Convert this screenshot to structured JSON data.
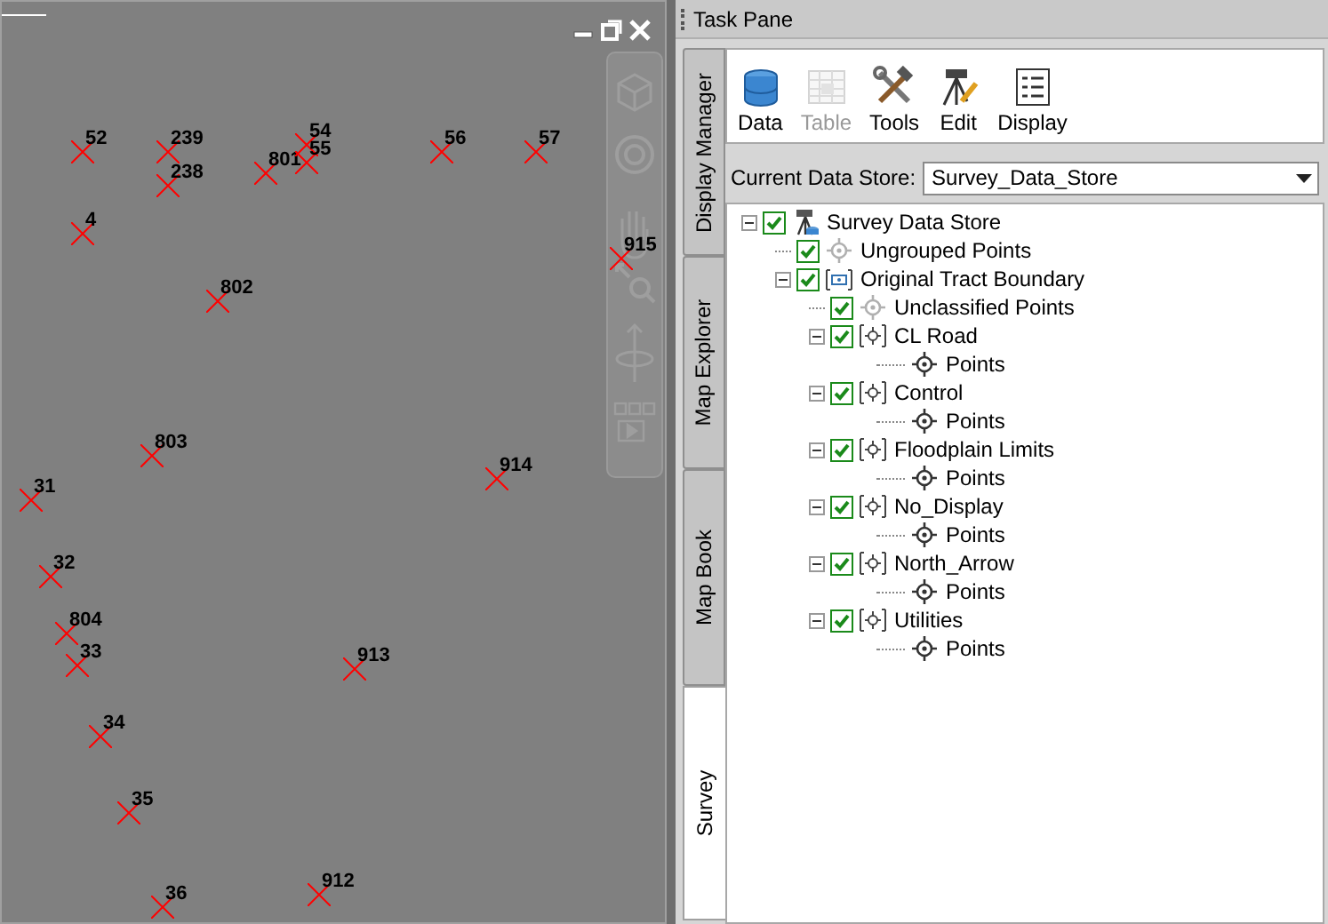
{
  "map_window": {
    "controls": [
      {
        "kind": "minimize"
      },
      {
        "kind": "restore"
      },
      {
        "kind": "close"
      }
    ],
    "points": [
      {
        "label": "52"
      },
      {
        "label": "239"
      },
      {
        "label": "238"
      },
      {
        "label": "801"
      },
      {
        "label": "54"
      },
      {
        "label": "55"
      },
      {
        "label": "56"
      },
      {
        "label": "57"
      },
      {
        "label": "4"
      },
      {
        "label": "802"
      },
      {
        "label": "915"
      },
      {
        "label": "803"
      },
      {
        "label": "31"
      },
      {
        "label": "914"
      },
      {
        "label": "32"
      },
      {
        "label": "804"
      },
      {
        "label": "33"
      },
      {
        "label": "34"
      },
      {
        "label": "913"
      },
      {
        "label": "35"
      },
      {
        "label": "36"
      },
      {
        "label": "912"
      }
    ]
  },
  "task_pane": {
    "title": "Task Pane",
    "side_tabs": [
      {
        "label": "Display Manager",
        "selected": false
      },
      {
        "label": "Map Explorer",
        "selected": false
      },
      {
        "label": "Map Book",
        "selected": false
      },
      {
        "label": "Survey",
        "selected": true
      }
    ],
    "toolbar": [
      {
        "kind": "data",
        "label": "Data",
        "disabled": false
      },
      {
        "kind": "table",
        "label": "Table",
        "disabled": true
      },
      {
        "kind": "tools",
        "label": "Tools",
        "disabled": false
      },
      {
        "kind": "edit",
        "label": "Edit",
        "disabled": false
      },
      {
        "kind": "display",
        "label": "Display",
        "disabled": false
      }
    ],
    "data_store": {
      "label": "Current Data Store:",
      "value": "Survey_Data_Store"
    },
    "tree": [
      {
        "kind": "store",
        "label": "Survey Data Store",
        "checked": true,
        "expanded": true,
        "children": [
          {
            "kind": "ungrouped",
            "label": "Ungrouped Points",
            "checked": true
          },
          {
            "kind": "boundary",
            "label": "Original Tract Boundary",
            "checked": true,
            "expanded": true,
            "children": [
              {
                "kind": "ungrouped",
                "label": "Unclassified Points",
                "checked": true
              },
              {
                "kind": "group",
                "label": "CL Road",
                "checked": true,
                "expanded": true,
                "children": [
                  {
                    "kind": "points",
                    "label": "Points"
                  }
                ]
              },
              {
                "kind": "group",
                "label": "Control",
                "checked": true,
                "expanded": true,
                "children": [
                  {
                    "kind": "points",
                    "label": "Points"
                  }
                ]
              },
              {
                "kind": "group",
                "label": "Floodplain Limits",
                "checked": true,
                "expanded": true,
                "children": [
                  {
                    "kind": "points",
                    "label": "Points"
                  }
                ]
              },
              {
                "kind": "group",
                "label": "No_Display",
                "checked": true,
                "expanded": true,
                "children": [
                  {
                    "kind": "points",
                    "label": "Points"
                  }
                ]
              },
              {
                "kind": "group",
                "label": "North_Arrow",
                "checked": true,
                "expanded": true,
                "children": [
                  {
                    "kind": "points",
                    "label": "Points"
                  }
                ]
              },
              {
                "kind": "group",
                "label": "Utilities",
                "checked": true,
                "expanded": true,
                "children": [
                  {
                    "kind": "points",
                    "label": "Points"
                  }
                ]
              }
            ]
          }
        ]
      }
    ]
  }
}
